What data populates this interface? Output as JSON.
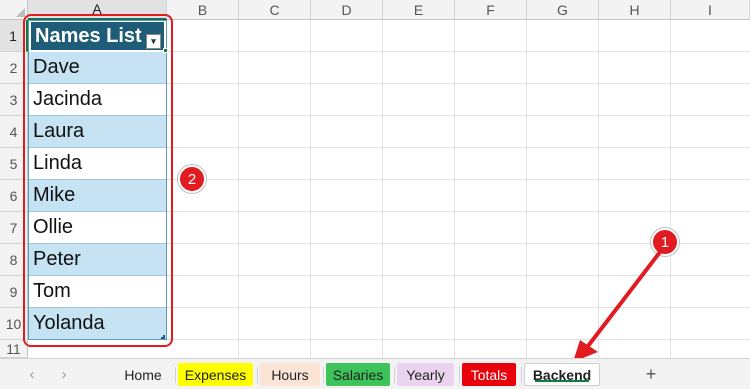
{
  "columns": [
    "A",
    "B",
    "C",
    "D",
    "E",
    "F",
    "G",
    "H",
    "I"
  ],
  "rows": [
    "1",
    "2",
    "3",
    "4",
    "5",
    "6",
    "7",
    "8",
    "9",
    "10",
    "11"
  ],
  "table": {
    "header": "Names List",
    "filter_icon": "sort-filter-icon",
    "names": [
      "Dave",
      "Jacinda",
      "Laura",
      "Linda",
      "Mike",
      "Ollie",
      "Peter",
      "Tom",
      "Yolanda"
    ],
    "header_color": "#1f5c78",
    "band_color": "#c5e3f2"
  },
  "annotations": {
    "badge_1": "1",
    "badge_2": "2",
    "color": "#e11b22"
  },
  "sheet_tabs": [
    {
      "label": "Home",
      "color": "#f3f3f3"
    },
    {
      "label": "Expenses",
      "color": "#ffff00"
    },
    {
      "label": "Hours",
      "color": "#fbe3d6"
    },
    {
      "label": "Salaries",
      "color": "#3cc35a"
    },
    {
      "label": "Yearly",
      "color": "#ead3ee"
    },
    {
      "label": "Totals",
      "color": "#e8000d"
    },
    {
      "label": "Backend",
      "color": "#ffffff"
    }
  ],
  "nav": {
    "prev_icon": "chevron-left-icon",
    "next_icon": "chevron-right-icon",
    "add_sheet_icon": "plus-icon",
    "add_label": "+"
  },
  "accent_color": "#107c41"
}
